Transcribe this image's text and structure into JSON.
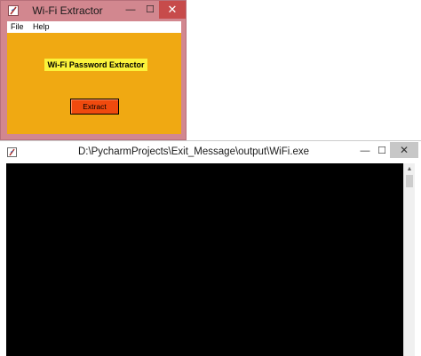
{
  "tk_window": {
    "title": "Wi-Fi Extractor",
    "icon": "tk-feather-icon",
    "controls": {
      "minimize": "—",
      "maximize": "☐",
      "close": "✕"
    },
    "menu": [
      "File",
      "Help"
    ],
    "label": "Wi-Fi Password Extractor",
    "button_label": "Extract",
    "colors": {
      "frame": "#d2878f",
      "background": "#f0a912",
      "label_bg": "#fbf23a",
      "button_bg": "#f04a0e"
    }
  },
  "console_window": {
    "title": "D:\\PycharmProjects\\Exit_Message\\output\\WiFi.exe",
    "icon": "tk-feather-icon",
    "controls": {
      "minimize": "—",
      "maximize": "☐",
      "close": "✕"
    },
    "scroll_up": "▲",
    "colors": {
      "console_bg": "#000000"
    }
  }
}
